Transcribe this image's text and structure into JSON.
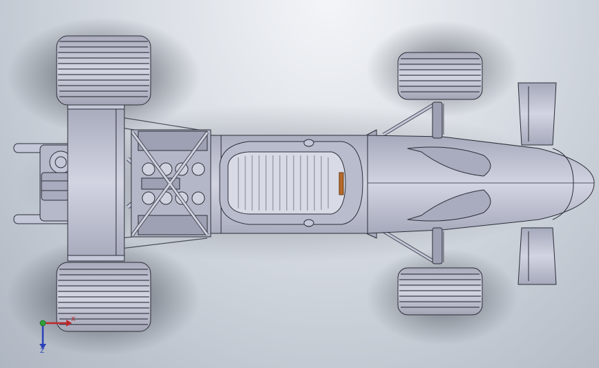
{
  "app": {
    "title": ""
  },
  "model": {
    "name": "formula-car-top-view",
    "view": "Top"
  },
  "triad": {
    "x_label": "X",
    "z_label": "Z"
  },
  "colors": {
    "background_top": "#f3f5f8",
    "background_bottom": "#aeb6c1",
    "model_fill": "#c4c7d8",
    "model_edge": "#2a2c36",
    "x_axis": "#c0262b",
    "y_axis": "#2fa13a",
    "z_axis": "#2a40b8",
    "accent_orange": "#b46a2a"
  },
  "icons": [
    "reference-triad-icon"
  ]
}
